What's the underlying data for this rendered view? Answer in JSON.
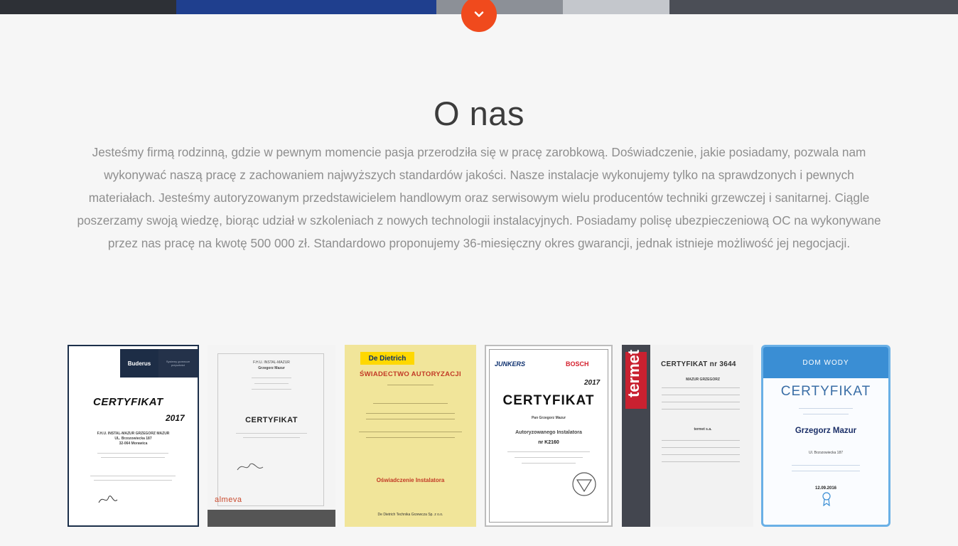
{
  "hero": {
    "strip_colors": [
      "#2f3238",
      "#1f3e8f",
      "#8a8e95",
      "#c7cacf",
      "#4a4d55"
    ]
  },
  "scroll_button": {
    "icon": "chevron-down-icon",
    "color": "#f04a1d"
  },
  "about": {
    "title": "O nas",
    "text": "Jesteśmy firmą rodzinną, gdzie w pewnym momencie pasja przerodziła się w pracę zarobkową. Doświadczenie, jakie posiadamy, pozwala nam wykonywać naszą pracę z zachowaniem najwyższych standardów jakości. Nasze instalacje wykonujemy tylko na sprawdzonych i pewnych materiałach. Jesteśmy autoryzowanym przedstawicielem handlowym oraz serwisowym wielu producentów techniki grzewczej i sanitarnej. Ciągle poszerzamy swoją wiedzę, biorąc udział w szkoleniach z nowych technologii instalacyjnych. Posiadamy polisę ubezpieczeniową OC na wykonywane przez nas pracę na kwotę 500 000 zł. Standardowo proponujemy 36-miesięczny okres gwarancji, jednak istnieje możliwość jej negocjacji."
  },
  "certificates": [
    {
      "logo": "Buderus",
      "tagline": "Systemy grzewcze przyszłości",
      "title": "CERTYFIKAT",
      "year": "2017",
      "holder": "F.H.U. INSTAL-MAZUR GRZEGORZ MAZUR",
      "address": "UL. Brzozowiecka 187",
      "city": "32-064 Morawica"
    },
    {
      "title": "CERTYFIKAT",
      "company": "F.H.U. INSTAL-MAZUR",
      "name": "Grzegorz Mazur",
      "brand": "almeva"
    },
    {
      "logo": "De Dietrich",
      "title": "ŚWIADECTWO AUTORYZACJI",
      "subtitle": "Oświadczenie Instalatora",
      "footer": "De Dietrich Technika Grzewcza Sp. z o.o."
    },
    {
      "logo_left": "JUNKERS",
      "logo_right": "BOSCH",
      "year": "2017",
      "title": "CERTYFIKAT",
      "name": "Pan Grzegorz Mazur",
      "role": "Autoryzowanego Instalatora",
      "number": "nr K2160"
    },
    {
      "logo": "termet",
      "title": "CERTYFIKAT nr 3644",
      "name": "MAZUR GRZEGORZ",
      "company": "termet s.a."
    },
    {
      "logo": "DOM WODY",
      "title": "CERTYFIKAT",
      "name": "Grzegorz Mazur",
      "address": "Ul. Brzozowiecka 187",
      "date": "12.09.2016"
    }
  ]
}
